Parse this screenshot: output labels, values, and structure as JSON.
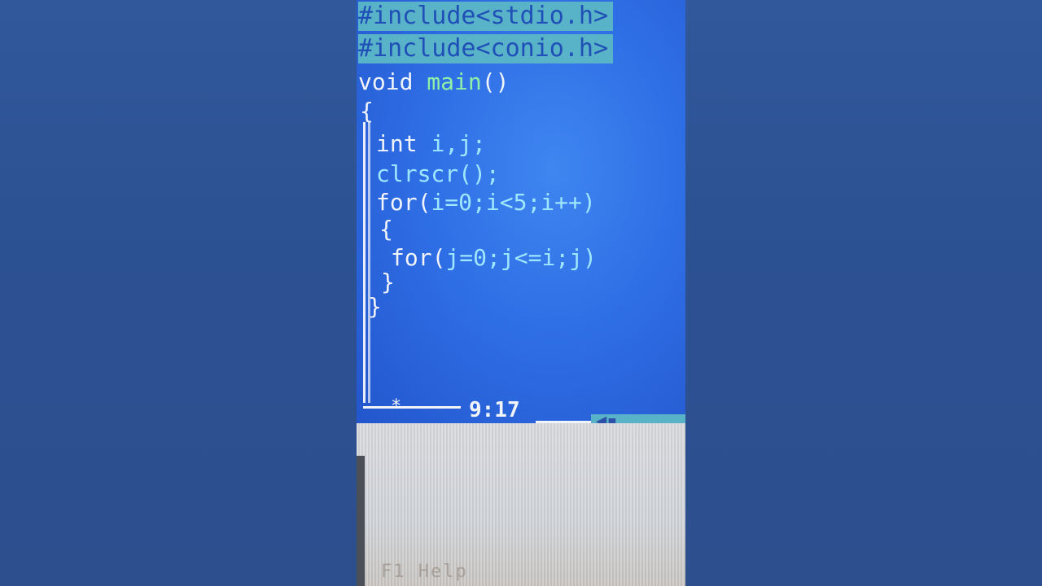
{
  "editor": {
    "includes": [
      "#include<stdio.h>",
      "#include<conio.h>"
    ],
    "lines": [
      {
        "parts": [
          {
            "t": "void ",
            "c": "kw"
          },
          {
            "t": "main",
            "c": "fn"
          },
          {
            "t": "()",
            "c": "kw"
          }
        ]
      },
      {
        "parts": [
          {
            "t": "{",
            "c": "kw"
          }
        ]
      },
      {
        "parts": [
          {
            "t": "int ",
            "c": "kw"
          },
          {
            "t": "i,j;",
            "c": "id"
          }
        ]
      },
      {
        "parts": [
          {
            "t": "clrscr();",
            "c": "id"
          }
        ]
      },
      {
        "parts": [
          {
            "t": "for(",
            "c": "kw"
          },
          {
            "t": "i=0;i<5;i++)",
            "c": "id"
          }
        ]
      },
      {
        "parts": [
          {
            "t": "{",
            "c": "kw"
          }
        ]
      },
      {
        "parts": [
          {
            "t": "for(",
            "c": "kw"
          },
          {
            "t": "j=0;j<=i;j)",
            "c": "id"
          }
        ]
      },
      {
        "parts": [
          {
            "t": "}",
            "c": "kw"
          }
        ]
      },
      {
        "parts": [
          {
            "t": "}",
            "c": "kw"
          }
        ]
      }
    ]
  },
  "status": {
    "cursor_position": "9:17",
    "modified_marker": "*",
    "scroll_arrow": "◀▪"
  },
  "bottom": {
    "help_text": "F1 Help"
  },
  "colors": {
    "editor_bg": "#2f6fe6",
    "include_highlight": "#58b3c8",
    "function_name": "#8ff0a8",
    "identifier": "#9ee7ff"
  }
}
